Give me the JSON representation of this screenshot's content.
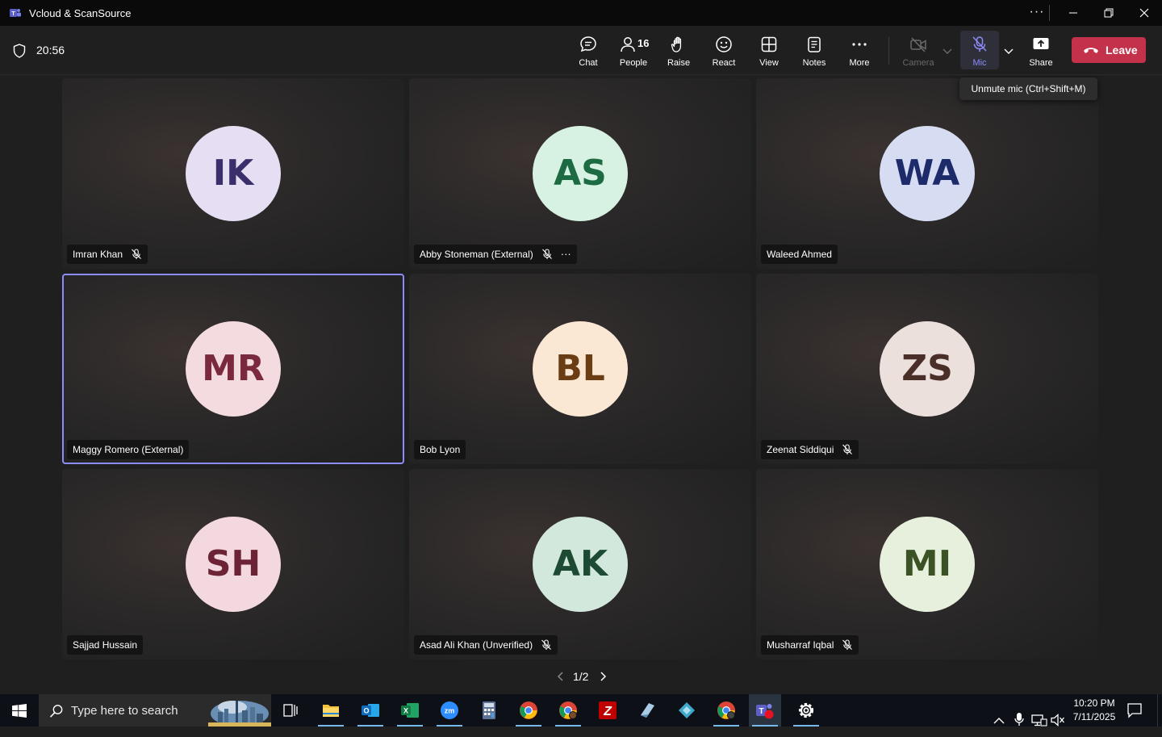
{
  "window": {
    "title": "Vcloud & ScanSource",
    "more_label": "···"
  },
  "meeting": {
    "timer": "20:56",
    "toolbar": {
      "chat": "Chat",
      "people": "People",
      "people_count": "16",
      "raise": "Raise",
      "react": "React",
      "view": "View",
      "notes": "Notes",
      "more": "More",
      "camera": "Camera",
      "mic": "Mic",
      "share": "Share",
      "leave": "Leave"
    },
    "tooltip": "Unmute mic (Ctrl+Shift+M)",
    "participants": [
      {
        "initials": "IK",
        "name": "Imran Khan",
        "muted": true,
        "bg": "#e6dff3",
        "fg": "#3b2f6b"
      },
      {
        "initials": "AS",
        "name": "Abby Stoneman (External)",
        "muted": true,
        "more": "···",
        "bg": "#d7f2e3",
        "fg": "#1c6b42"
      },
      {
        "initials": "WA",
        "name": "Waleed Ahmed",
        "muted": false,
        "bg": "#d6dcf2",
        "fg": "#1d2b6b"
      },
      {
        "initials": "MR",
        "name": "Maggy Romero (External)",
        "muted": false,
        "active": true,
        "bg": "#f3dbe0",
        "fg": "#7a2a3c"
      },
      {
        "initials": "BL",
        "name": "Bob Lyon",
        "muted": false,
        "bg": "#fbe8d4",
        "fg": "#6b3d14"
      },
      {
        "initials": "ZS",
        "name": "Zeenat Siddiqui",
        "muted": true,
        "bg": "#ece0dc",
        "fg": "#4a2f28"
      },
      {
        "initials": "SH",
        "name": "Sajjad Hussain",
        "muted": false,
        "bg": "#f3d9df",
        "fg": "#6b2335"
      },
      {
        "initials": "AK",
        "name": "Asad Ali Khan (Unverified)",
        "muted": true,
        "bg": "#d3e8dc",
        "fg": "#1d4a33"
      },
      {
        "initials": "MI",
        "name": "Musharraf Iqbal",
        "muted": true,
        "bg": "#e6f0dc",
        "fg": "#3b5224"
      }
    ],
    "pager": "1/2"
  },
  "taskbar": {
    "search_placeholder": "Type here to search",
    "apps": [
      {
        "name": "file-explorer-icon",
        "color": "#f4c23d"
      },
      {
        "name": "outlook-icon",
        "color": "#0f6cbd"
      },
      {
        "name": "excel-icon",
        "color": "#1d7044"
      },
      {
        "name": "zoom-icon",
        "color": "#2d8cff"
      },
      {
        "name": "calculator-icon",
        "color": "#6b7fa3"
      },
      {
        "name": "chrome-icon",
        "color": "#34a853"
      },
      {
        "name": "chrome-profile-icon",
        "color": "#ea4335"
      },
      {
        "name": "filezilla-icon",
        "color": "#bf0000"
      },
      {
        "name": "app-blue-icon",
        "color": "#7fb2d9"
      },
      {
        "name": "app-diamond-icon",
        "color": "#3fa9c9"
      },
      {
        "name": "chrome-guest-icon",
        "color": "#fbbc05"
      },
      {
        "name": "teams-icon",
        "color": "#5b5fc7"
      },
      {
        "name": "settings-icon",
        "color": "#ffffff"
      }
    ],
    "time": "10:20 PM",
    "date": "7/11/2025"
  }
}
